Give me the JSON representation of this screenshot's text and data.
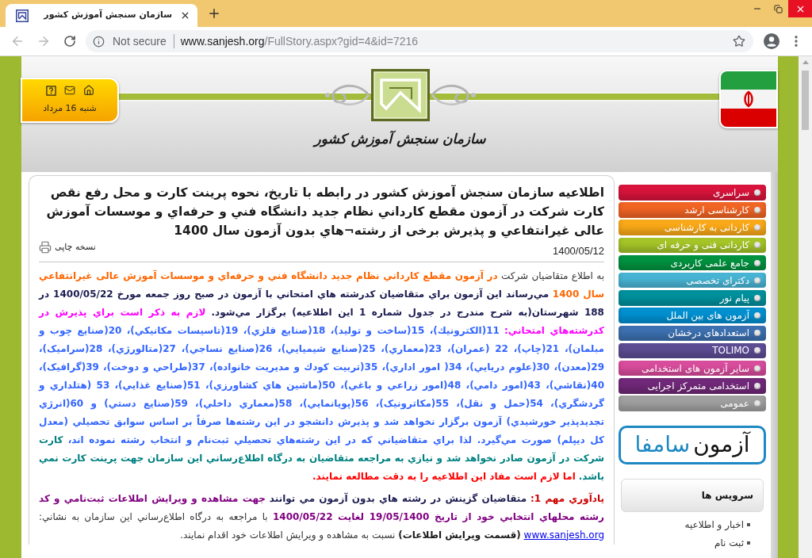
{
  "browser": {
    "tab_title": "سازمان سنجش آموزش کشور",
    "security_label": "Not secure",
    "url_host": "www.sanjesh.org",
    "url_path": "/FullStory.aspx?gid=4&id=7216"
  },
  "header": {
    "date": "شنبه 16 مرداد",
    "logo_text": "سازمان سنجش آموزش کشور"
  },
  "article": {
    "title": "اطلاعیه سازمان سنجش آموزش کشور در رابطه با تاریخ، نحوه پرینت کارت و محل رفع نقص کارت شرکت در آزمون مقطع كارداني نظام جديد دانشگاه فني و حرفه‌اي و موسسات آموزش عالی غیرانتفاعي و پذيرش برخی از رشته¬هاي بدون آزمون سال 1400",
    "print_link": "نسخه چاپی",
    "date": "1400/05/12",
    "paragraphs": [
      {
        "runs": [
          {
            "kind": "text",
            "text": "به اطلاع متقاضیان شرکت",
            "color": "#333333",
            "bold": false
          },
          {
            "kind": "text",
            "text": "در آزمون مقطع كارداني نظام جديد دانشگاه فني و حرفه‌اي و موسسات آموزش عالی غیرانتفاعي سال 1400",
            "color": "#ff6600",
            "bold": true
          },
          {
            "kind": "text",
            "text": "مي‌رساند اين آزمون براي متقاضيان كدرشته هاي امتحاني با آزمون در صبح روز جمعه مورخ 1400/05/22 در 188 شهرستان(به شرح مندرج در جدول شماره 1 اين اطلاعيه) برگزار مي‌شود.",
            "color": "#1c1c50",
            "bold": true
          },
          {
            "kind": "text",
            "text": "لازم به ذکر است براي پذيرش در كدرشته‌هاي امتحاني:",
            "color": "#ff00ff",
            "bold": true
          },
          {
            "kind": "text",
            "text": "11(الكترونيك)، 15(ساخت و توليد)، 18(صنايع فلزي)، 19(تاسيسات مكانيكي)، 20(صنايع چوب و مبلمان)، 21(چاپ)، 22 (عمران)، 23(معماري)، 25(صنايع شيميايي)، 26(صنايع نساجي)، 27(متالورژي)، 28(سراميک)، 29(معدن)، 30(علوم دريايي)، 34( امور اداري)، 35(تربيت كودك و مديريت خانواده)، 37(طراحي و دوخت)، 39(گرافيک)، 40(نقاشي)، 43(امور دامي)، 48(امور زراعي و باغي)، 50(ماشين هاي كشاورزي)، 51(صنايع غذايي)، 53 (هتلداري و گردشگري)، 54(حمل و نقل)، 55(مكاترونيک)، 56(پويانمايي)، 58(معماري داخلي)، 59(صنايع دستي) و 60(انرژي تجديدپذير خورشيدي) آزمون برگزار نخواهد شد و پذيرش دانشجو در اين رشته‌ها صرفاً بر اساس سوابق تحصيلي (معدل كل ديپلم) صورت مي‌گيرد. لذا براي متقاضياني كه در اين رشته‌هاي تحصيلي ثبت‌نام و انتخاب رشته نموده اند،",
            "color": "#3366ff",
            "bold": true
          },
          {
            "kind": "text",
            "text": "كارت شركت در آزمون صادر نخواهد شد و نيازي به مراجعه متقاضيان به درگاه اطلاع‌رساني اين سازمان جهت پرينت كارت نمي باشد.",
            "color": "#008080",
            "bold": true
          },
          {
            "kind": "text",
            "text": "اما لازم است مفاد اين اطلاعيه را به دقت مطالعه نمايند.",
            "color": "#ff0000",
            "bold": true
          }
        ]
      },
      {
        "runs": [
          {
            "kind": "text",
            "text": "يادآوري مهم 1:",
            "color": "#cc0000",
            "bold": true
          },
          {
            "kind": "text",
            "text": "متقاضيان گزينش در رشته هاي بدون آزمون مي توانند",
            "color": "#1c1c50",
            "bold": true
          },
          {
            "kind": "text",
            "text": "جهت مشاهده و ويرايش اطلاعات ثبت‌نامي و كد رشته محلهاي انتخابي خود از تاريخ 19/05/1400 لغايت 1400/05/22",
            "color": "#800080",
            "bold": true
          },
          {
            "kind": "text",
            "text": "با مراجعه به درگاه اطلاع‌رساني اين سازمان به نشاني:",
            "color": "#333333",
            "bold": false
          },
          {
            "kind": "link",
            "text": "www.sanjesh.org"
          },
          {
            "kind": "text",
            "text": "(قسمت ويرايش اطلاعات)",
            "color": "#1a1a1a",
            "bold": true
          },
          {
            "kind": "text",
            "text": "نسبت به مشاهده و ويرايش اطلاعات خود اقدام نمايند.",
            "color": "#333333",
            "bold": false
          }
        ]
      }
    ]
  },
  "sidebar": {
    "menu": [
      {
        "label": "سراسری",
        "color": "#d8143c"
      },
      {
        "label": "کارشناسی ارشد",
        "color": "#f06424"
      },
      {
        "label": "کاردانی به کارشناسی",
        "color": "#f8a818"
      },
      {
        "label": "کاردانی فنی و حرفه ای",
        "color": "#a4c428"
      },
      {
        "label": "جامع علمی کاربردی",
        "color": "#00923f"
      },
      {
        "label": "دکترای تخصصی",
        "color": "#48b4d4"
      },
      {
        "label": "پیام نور",
        "color": "#00909c"
      },
      {
        "label": "آزمون های بین الملل",
        "color": "#0090d0"
      },
      {
        "label": "استعدادهای درخشان",
        "color": "#3c70b0"
      },
      {
        "label": "TOLIMO",
        "color": "#5c4c94"
      },
      {
        "label": "سایر آزمون های استخدامی",
        "color": "#d84c9c"
      },
      {
        "label": "استخدامی متمرکز اجرایی",
        "color": "#702878"
      },
      {
        "label": "عمومی",
        "color": "#a0a0a0"
      }
    ],
    "ad": {
      "word_1": "آزمون",
      "word_2": "سامفا"
    },
    "services": {
      "title": "سرویس ها",
      "items": [
        "اخبار و اطلاعیه",
        "ثبت نام"
      ]
    }
  }
}
